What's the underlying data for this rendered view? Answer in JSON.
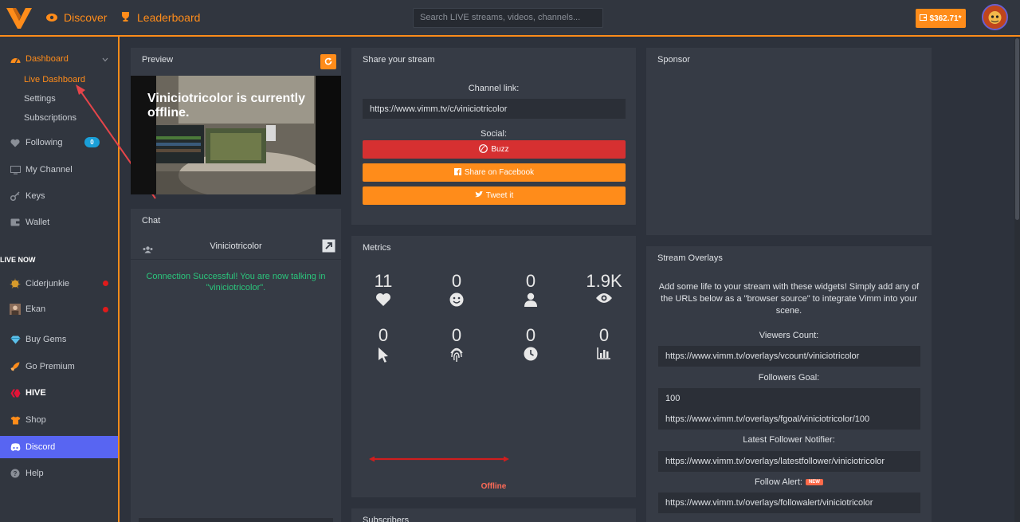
{
  "topbar": {
    "discover": "Discover",
    "leaderboard": "Leaderboard",
    "search_placeholder": "Search LIVE streams, videos, channels...",
    "balance": "$362.71*"
  },
  "sidebar": {
    "dashboard": "Dashboard",
    "live_dashboard": "Live Dashboard",
    "settings": "Settings",
    "subscriptions": "Subscriptions",
    "following": "Following",
    "following_count": "0",
    "my_channel": "My Channel",
    "keys": "Keys",
    "wallet": "Wallet",
    "live_now": "LIVE NOW",
    "live": [
      {
        "name": "Ciderjunkie"
      },
      {
        "name": "Ekan"
      }
    ],
    "buy_gems": "Buy Gems",
    "go_premium": "Go Premium",
    "hive": "HIVE",
    "shop": "Shop",
    "discord": "Discord",
    "help": "Help"
  },
  "preview": {
    "title": "Preview",
    "offline_text": "Viniciotricolor is currently offline."
  },
  "chat": {
    "title": "Chat",
    "channel": "Viniciotricolor",
    "message": "Connection Successful! You are now talking in \"viniciotricolor\"."
  },
  "share": {
    "title": "Share your stream",
    "channel_label": "Channel link:",
    "channel_link": "https://www.vimm.tv/c/viniciotricolor",
    "social_label": "Social:",
    "buzz": "Buzz",
    "facebook": "Share on Facebook",
    "tweet": "Tweet it"
  },
  "metrics": {
    "title": "Metrics",
    "row1": [
      "11",
      "0",
      "0",
      "1.9K"
    ],
    "row2": [
      "0",
      "0",
      "0",
      "0"
    ],
    "status": "Offline"
  },
  "subscribers": {
    "title": "Subscribers"
  },
  "sponsor": {
    "title": "Sponsor"
  },
  "overlays": {
    "title": "Stream Overlays",
    "description": "Add some life to your stream with these widgets! Simply add any of the URLs below as a \"browser source\" to integrate Vimm into your scene.",
    "viewers_label": "Viewers Count:",
    "viewers_url": "https://www.vimm.tv/overlays/vcount/viniciotricolor",
    "followers_goal_label": "Followers Goal:",
    "followers_goal_value": "100",
    "followers_goal_url": "https://www.vimm.tv/overlays/fgoal/viniciotricolor/100",
    "latest_label": "Latest Follower Notifier:",
    "latest_url": "https://www.vimm.tv/overlays/latestfollower/viniciotricolor",
    "follow_alert_label": "Follow Alert:",
    "new_badge": "NEW",
    "follow_alert_url": "https://www.vimm.tv/overlays/followalert/viniciotricolor"
  },
  "colors": {
    "accent": "#ff8c1a",
    "discord": "#5865f2",
    "buzz": "#d63031",
    "chat_green": "#2bc67c"
  }
}
